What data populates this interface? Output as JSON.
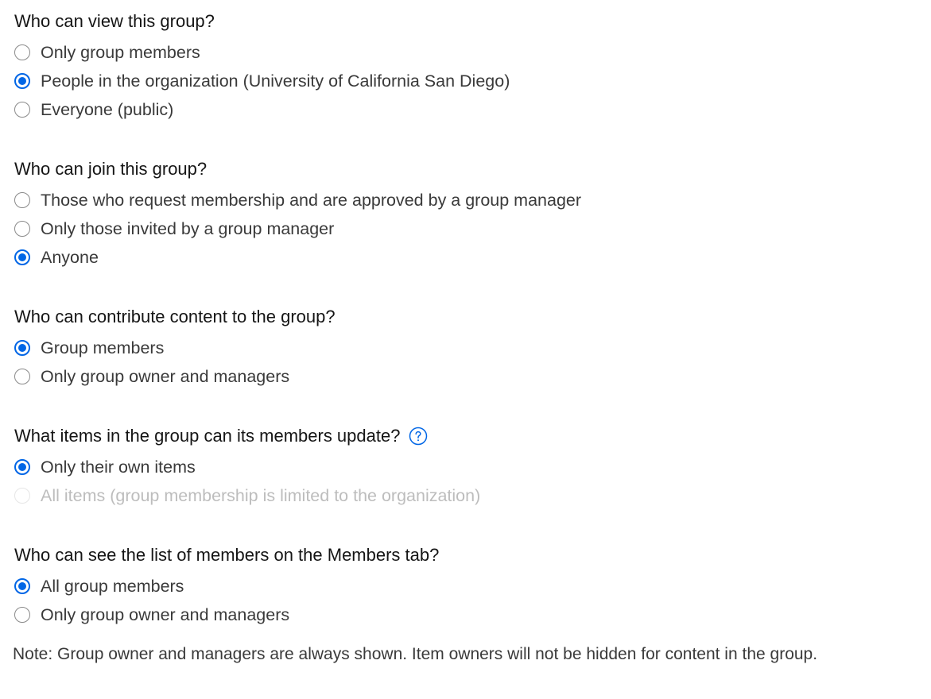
{
  "questions": [
    {
      "label": "Who can view this group?",
      "options": [
        {
          "label": "Only group members",
          "checked": false,
          "disabled": false
        },
        {
          "label": "People in the organization (University of California San Diego)",
          "checked": true,
          "disabled": false
        },
        {
          "label": "Everyone (public)",
          "checked": false,
          "disabled": false
        }
      ]
    },
    {
      "label": "Who can join this group?",
      "options": [
        {
          "label": "Those who request membership and are approved by a group manager",
          "checked": false,
          "disabled": false
        },
        {
          "label": "Only those invited by a group manager",
          "checked": false,
          "disabled": false
        },
        {
          "label": "Anyone",
          "checked": true,
          "disabled": false
        }
      ]
    },
    {
      "label": "Who can contribute content to the group?",
      "options": [
        {
          "label": "Group members",
          "checked": true,
          "disabled": false
        },
        {
          "label": "Only group owner and managers",
          "checked": false,
          "disabled": false
        }
      ]
    },
    {
      "label": "What items in the group can its members update?",
      "help_icon": "question-circle-icon",
      "options": [
        {
          "label": "Only their own items",
          "checked": true,
          "disabled": false
        },
        {
          "label": "All items (group membership is limited to the organization)",
          "checked": false,
          "disabled": true
        }
      ]
    },
    {
      "label": "Who can see the list of members on the Members tab?",
      "options": [
        {
          "label": "All group members",
          "checked": true,
          "disabled": false
        },
        {
          "label": "Only group owner and managers",
          "checked": false,
          "disabled": false
        }
      ]
    }
  ],
  "note": "Note: Group owner and managers are always shown. Item owners will not be hidden for content in the group.",
  "colors": {
    "accent": "#0066e6",
    "text": "#151515",
    "option_text": "#3a3a3a",
    "disabled_text": "#bdbdbd"
  }
}
